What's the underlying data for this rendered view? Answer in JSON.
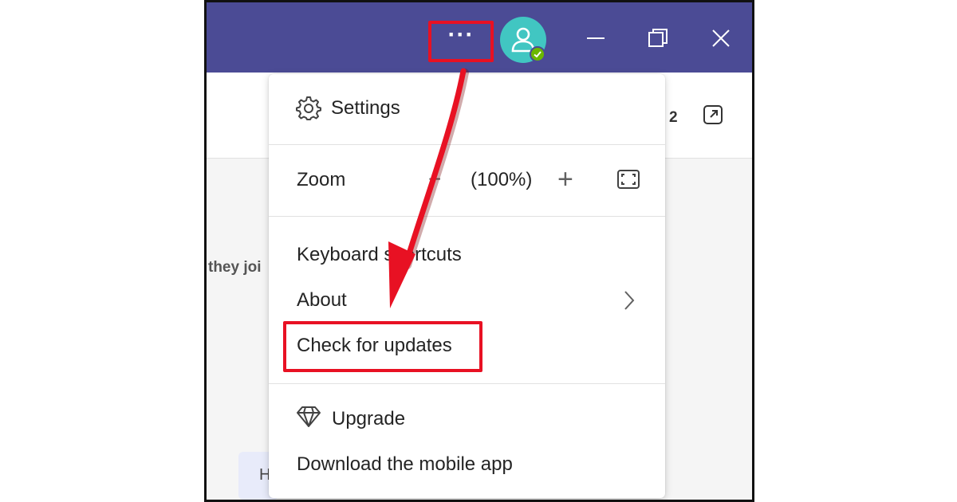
{
  "titlebar": {
    "more_label": "···",
    "accent_color": "#4b4b95",
    "avatar_color": "#41c6c2",
    "presence": "available"
  },
  "background": {
    "count_text": "2",
    "side_text": "they joi",
    "pill_text": "H"
  },
  "menu": {
    "settings_label": "Settings",
    "zoom_label": "Zoom",
    "zoom_minus": "−",
    "zoom_value": "(100%)",
    "zoom_plus": "+",
    "keyboard_shortcuts_label": "Keyboard shortcuts",
    "about_label": "About",
    "check_updates_label": "Check for updates",
    "upgrade_label": "Upgrade",
    "download_app_label": "Download the mobile app"
  },
  "annotation": {
    "highlight_color": "#e81123"
  },
  "icons": [
    "more-options-icon",
    "avatar-icon",
    "presence-check-icon",
    "minimize-icon",
    "maximize-icon",
    "close-icon",
    "popout-icon",
    "gear-icon",
    "fullscreen-icon",
    "chevron-right-icon",
    "diamond-icon"
  ]
}
